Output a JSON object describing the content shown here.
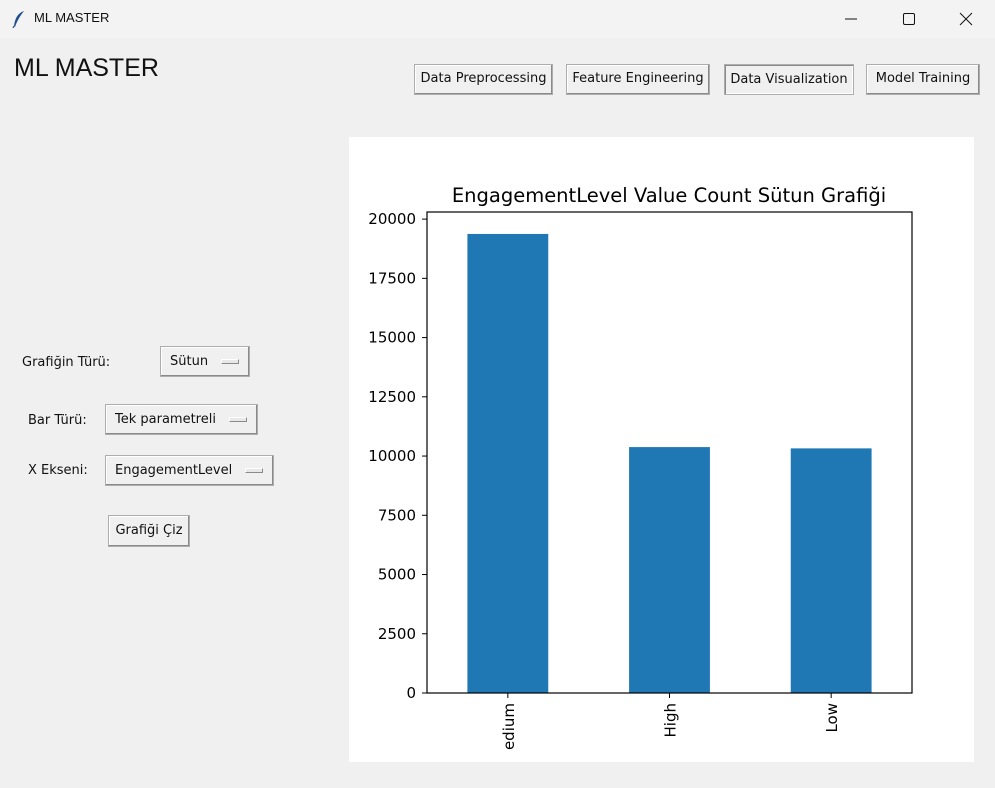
{
  "window": {
    "title": "ML MASTER",
    "icon": "feather-icon"
  },
  "app": {
    "heading": "ML MASTER"
  },
  "nav": {
    "preprocessing": "Data Preprocessing",
    "feature_engineering": "Feature Engineering",
    "visualization": "Data Visualization",
    "training": "Model Training",
    "active": "Data Visualization"
  },
  "controls": {
    "chart_type_label": "Grafiğin Türü:",
    "chart_type_value": "Sütun",
    "bar_type_label": "Bar Türü:",
    "bar_type_value": "Tek parametreli",
    "x_axis_label": "X Ekseni:",
    "x_axis_value": "EngagementLevel",
    "draw_button": "Grafiği Çiz"
  },
  "chart_data": {
    "type": "bar",
    "title": "EngagementLevel Value Count Sütun Grafiği",
    "categories": [
      "Medium",
      "High",
      "Low"
    ],
    "visible_category_labels": [
      "edium",
      "High",
      "Low"
    ],
    "values": [
      19374,
      10378,
      10324
    ],
    "ylim": [
      0,
      20300
    ],
    "yticks": [
      0,
      2500,
      5000,
      7500,
      10000,
      12500,
      15000,
      17500,
      20000
    ],
    "ytick_labels": [
      "0",
      "2500",
      "5000",
      "7500",
      "10000",
      "12500",
      "15000",
      "17500",
      "20000"
    ],
    "xlabel": "",
    "ylabel": "",
    "bar_color": "#1f77b4",
    "grid": false,
    "legend": "none"
  }
}
